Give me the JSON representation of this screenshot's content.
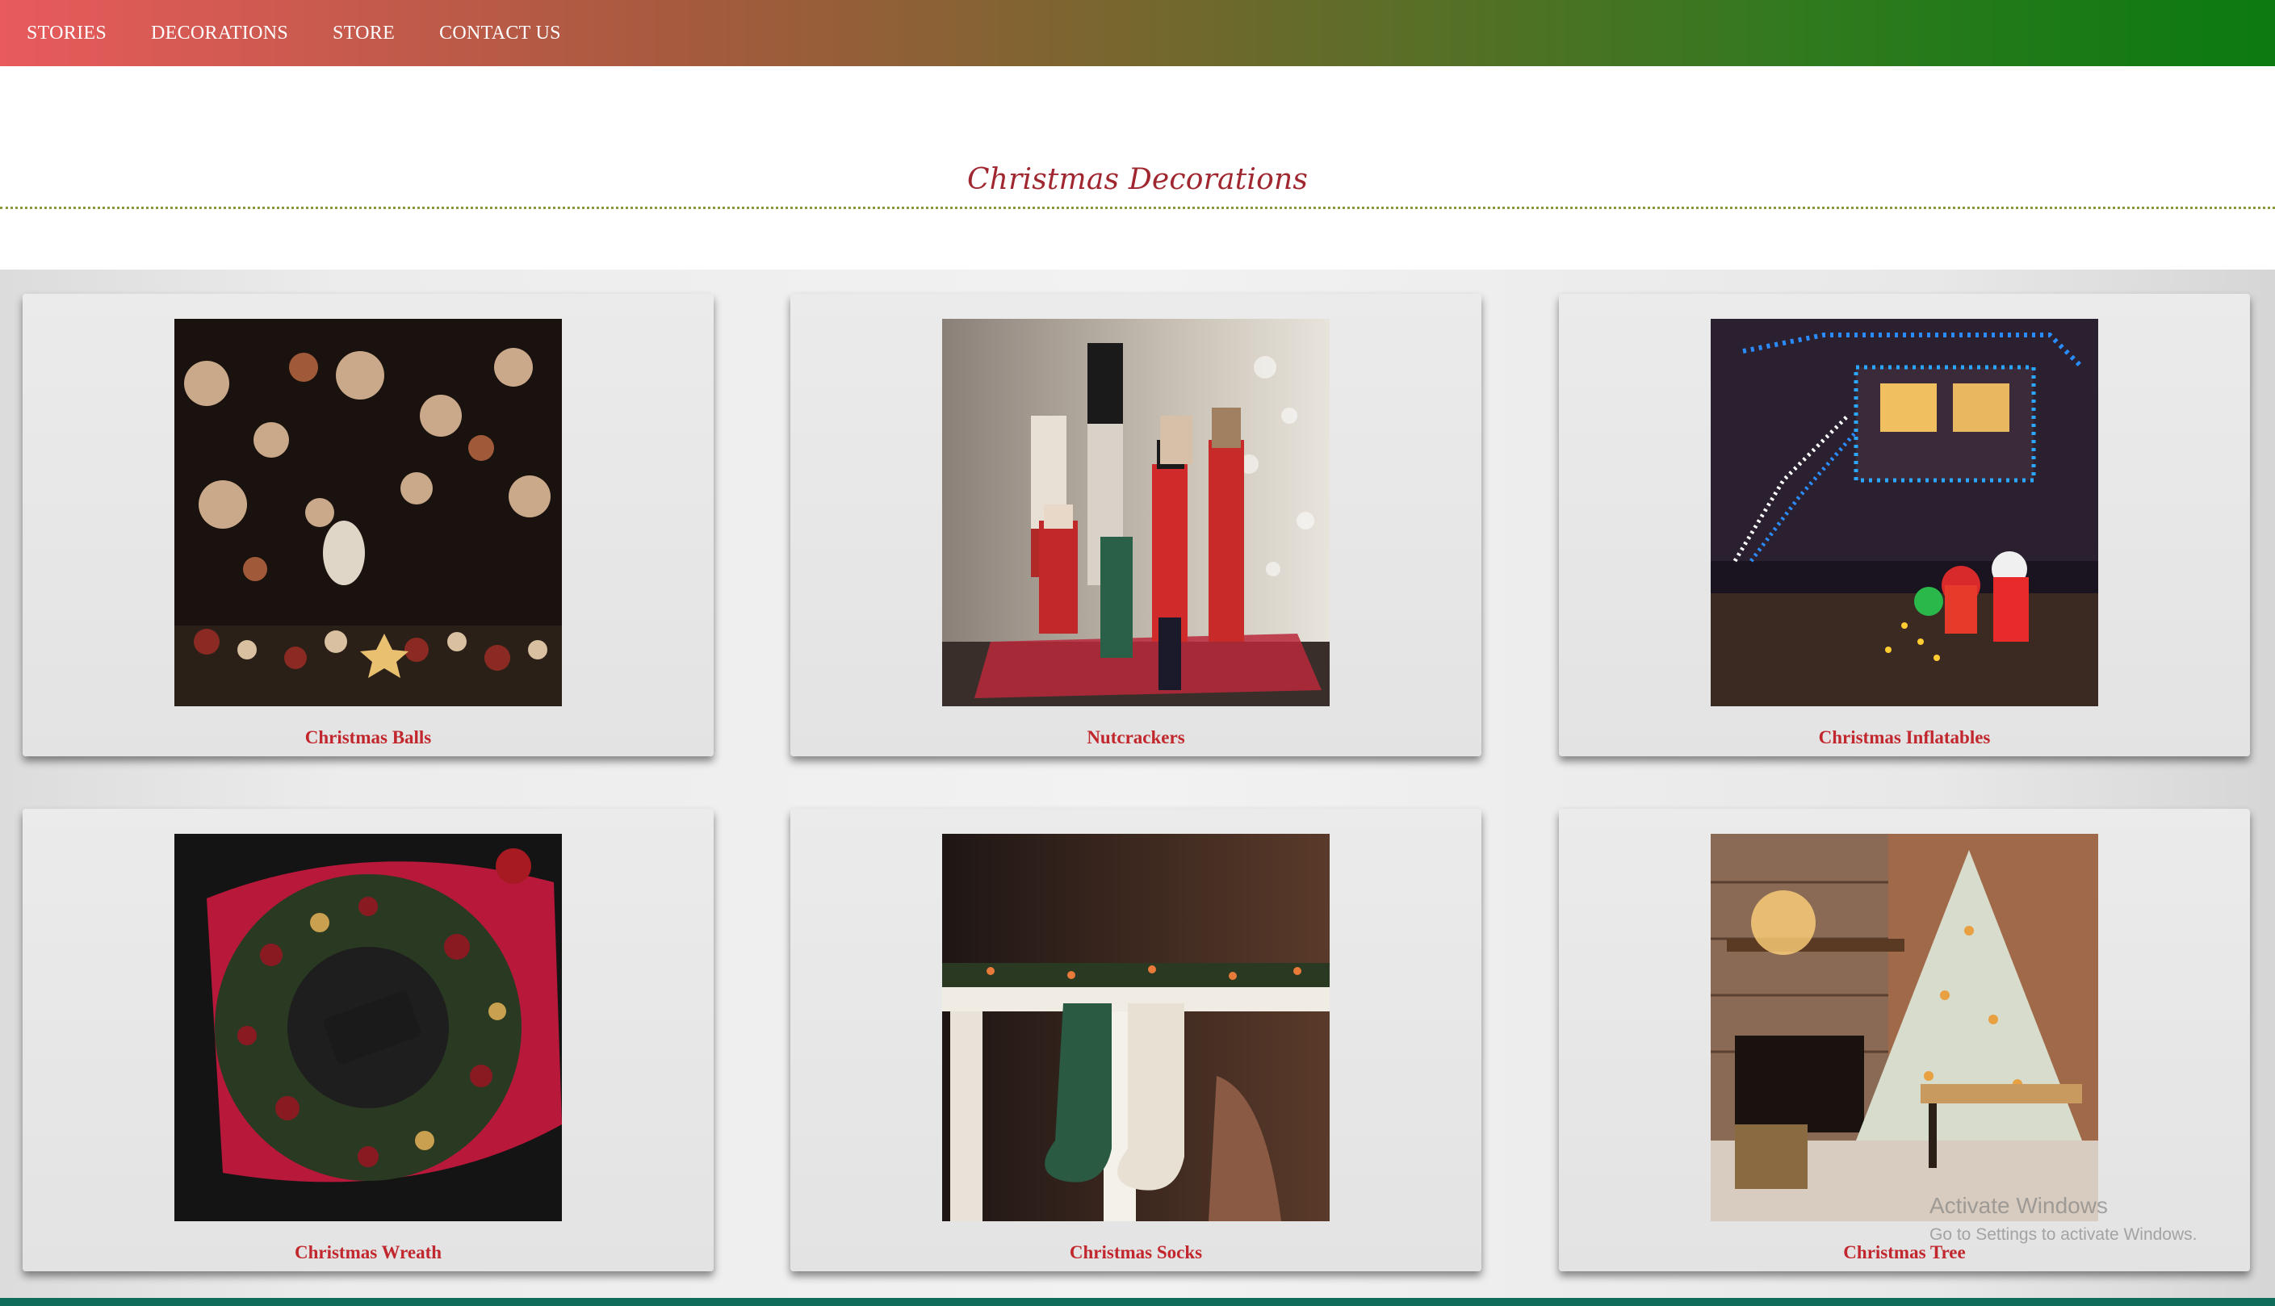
{
  "nav": {
    "items": [
      {
        "label": "STORIES"
      },
      {
        "label": "DECORATIONS"
      },
      {
        "label": "STORE"
      },
      {
        "label": "CONTACT US"
      }
    ]
  },
  "page": {
    "title": "Christmas Decorations"
  },
  "cards": [
    {
      "caption": "Christmas Balls",
      "image": "ornaments-photo"
    },
    {
      "caption": "Nutcrackers",
      "image": "nutcrackers-photo"
    },
    {
      "caption": "Christmas Inflatables",
      "image": "house-lights-photo"
    },
    {
      "caption": "Christmas Wreath",
      "image": "wreath-photo"
    },
    {
      "caption": "Christmas Socks",
      "image": "stockings-photo"
    },
    {
      "caption": "Christmas Tree",
      "image": "tree-photo"
    }
  ],
  "watermark": {
    "line1": "Activate Windows",
    "line2": "Go to Settings to activate Windows."
  }
}
